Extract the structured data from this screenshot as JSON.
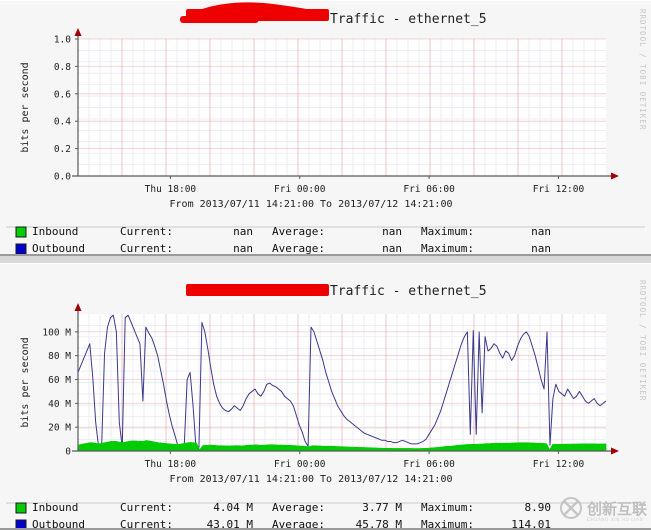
{
  "page": {
    "background_color": "#d8d8d8",
    "panel_background": "#f6f6f6",
    "watermark_vertical": "RRDTOOL / TOBI OETIKER",
    "logo": {
      "name": "chuangxin-hulian-logo",
      "text": "创新互联",
      "subtext": "CHUANG XIN HU LIAN"
    }
  },
  "colors": {
    "inbound": "#00cc00",
    "outbound": "#0000cc",
    "outbound_line": "#3a3a8c",
    "grid_major": "#e8a0a0",
    "grid_minor": "#d8d8e8",
    "axis": "#5a5a5a",
    "arrow": "#a00000",
    "redaction": "#ee0000"
  },
  "graphs": [
    {
      "id": "graph-top",
      "title": "Traffic - ethernet_5",
      "title_redacted": true,
      "ylabel": "bits per second",
      "range_text": "From 2013/07/11 14:21:00 To 2013/07/12 14:21:00",
      "legend": {
        "rows": [
          {
            "name": "Inbound",
            "swatch": "#00cc00",
            "current_label": "Current:",
            "current": "nan",
            "average_label": "Average:",
            "average": "nan",
            "maximum_label": "Maximum:",
            "maximum": "nan"
          },
          {
            "name": "Outbound",
            "swatch": "#0000cc",
            "current_label": "Current:",
            "current": "nan",
            "average_label": "Average:",
            "average": "nan",
            "maximum_label": "Maximum:",
            "maximum": "nan"
          }
        ]
      },
      "chart_data": {
        "type": "area",
        "title": "Traffic - ethernet_5",
        "xlabel": "",
        "ylabel": "bits per second",
        "grid": true,
        "legend_position": "below",
        "ylim": [
          0,
          1.0
        ],
        "yticks": [
          "0.0",
          "0.2",
          "0.4",
          "0.6",
          "0.8",
          "1.0"
        ],
        "ytick_values": [
          0,
          0.2,
          0.4,
          0.6,
          0.8,
          1.0
        ],
        "xticks": [
          "Thu 18:00",
          "Fri 00:00",
          "Fri 06:00",
          "Fri 12:00"
        ],
        "xtick_fractions": [
          0.175,
          0.42,
          0.665,
          0.91
        ],
        "series": [
          {
            "name": "Inbound",
            "values": []
          },
          {
            "name": "Outbound",
            "values": []
          }
        ],
        "note": "no data plotted (all nan)"
      }
    },
    {
      "id": "graph-bottom",
      "title": "Traffic - ethernet_5",
      "title_redacted": true,
      "ylabel": "bits per second",
      "range_text": "From 2013/07/11 14:21:00 To 2013/07/12 14:21:00",
      "legend": {
        "rows": [
          {
            "name": "Inbound",
            "swatch": "#00cc00",
            "current_label": "Current:",
            "current": "4.04 M",
            "average_label": "Average:",
            "average": "3.77 M",
            "maximum_label": "Maximum:",
            "maximum": "8.90"
          },
          {
            "name": "Outbound",
            "swatch": "#0000cc",
            "current_label": "Current:",
            "current": "43.01 M",
            "average_label": "Average:",
            "average": "45.78 M",
            "maximum_label": "Maximum:",
            "maximum": "114.01"
          }
        ]
      },
      "chart_data": {
        "type": "area",
        "title": "Traffic - ethernet_5",
        "xlabel": "",
        "ylabel": "bits per second",
        "grid": true,
        "legend_position": "below",
        "ylim": [
          0,
          115
        ],
        "yticks": [
          "0",
          "20 M",
          "40 M",
          "60 M",
          "80 M",
          "100 M"
        ],
        "ytick_values": [
          0,
          20,
          40,
          60,
          80,
          100
        ],
        "xticks": [
          "Thu 18:00",
          "Fri 00:00",
          "Fri 06:00",
          "Fri 12:00"
        ],
        "xtick_fractions": [
          0.175,
          0.42,
          0.665,
          0.91
        ],
        "units": "bits per second (M = megabits)",
        "series": [
          {
            "name": "Outbound",
            "color": "#0000cc",
            "style": "line",
            "values": [
              66,
              72,
              78,
              84,
              90,
              62,
              24,
              3,
              3,
              82,
              104,
              112,
              114,
              100,
              24,
              3,
              112,
              114,
              108,
              102,
              96,
              90,
              42,
              104,
              99,
              95,
              88,
              80,
              68,
              56,
              42,
              30,
              20,
              12,
              3,
              3,
              3,
              60,
              66,
              38,
              3,
              3,
              108,
              100,
              86,
              70,
              56,
              46,
              40,
              36,
              34,
              33,
              35,
              38,
              36,
              34,
              38,
              44,
              48,
              50,
              52,
              48,
              46,
              50,
              56,
              57,
              55,
              54,
              52,
              50,
              46,
              44,
              42,
              38,
              30,
              22,
              16,
              8,
              4,
              104,
              100,
              92,
              84,
              76,
              66,
              58,
              50,
              44,
              38,
              34,
              30,
              27,
              25,
              23,
              21,
              19,
              17,
              15,
              14,
              13,
              12,
              11,
              10,
              9,
              9,
              8,
              8,
              7,
              7,
              8,
              9,
              8,
              7,
              6,
              6,
              6,
              7,
              8,
              10,
              14,
              18,
              22,
              28,
              34,
              42,
              50,
              58,
              66,
              74,
              82,
              90,
              96,
              100,
              14,
              101,
              14,
              100,
              32,
              96,
              84,
              86,
              90,
              88,
              82,
              78,
              84,
              82,
              76,
              80,
              88,
              94,
              98,
              100,
              96,
              88,
              80,
              70,
              60,
              52,
              100,
              5,
              44,
              56,
              50,
              48,
              46,
              52,
              48,
              44,
              46,
              50,
              46,
              42,
              40,
              42,
              44,
              40,
              38,
              40,
              42
            ]
          },
          {
            "name": "Inbound",
            "color": "#00cc00",
            "style": "area",
            "values": [
              5,
              5.5,
              6,
              6.5,
              7,
              7,
              6.5,
              6,
              6.5,
              7,
              7.5,
              8,
              8.2,
              8,
              7.5,
              7,
              7.5,
              8,
              8.5,
              8.5,
              8.3,
              8.2,
              8,
              8.9,
              8.5,
              8,
              7.5,
              7,
              6.8,
              6.5,
              6.3,
              6,
              5.8,
              5.5,
              5.5,
              6,
              6.5,
              7,
              7.2,
              7,
              6.5,
              1,
              4.5,
              4.8,
              5,
              5,
              4.8,
              4.6,
              4.5,
              4.4,
              4.3,
              4.3,
              4.4,
              4.5,
              4.5,
              4.4,
              4.5,
              4.8,
              5,
              5,
              5.2,
              5,
              4.9,
              5,
              5.2,
              5.3,
              5.2,
              5.1,
              5,
              5,
              4.9,
              4.8,
              4.7,
              4.6,
              4.4,
              4.2,
              4,
              3.8,
              3.6,
              4.5,
              4.4,
              4.3,
              4.2,
              4.1,
              4,
              4,
              3.9,
              3.8,
              3.7,
              3.6,
              3.5,
              3.4,
              3.3,
              3.2,
              3.1,
              3,
              3,
              2.9,
              2.8,
              2.7,
              2.6,
              2.5,
              2.4,
              2.4,
              2.3,
              2.3,
              2.2,
              2.2,
              2.2,
              2.2,
              2.2,
              2.2,
              2.2,
              2.1,
              2.1,
              2.1,
              2.2,
              2.3,
              2.4,
              2.6,
              2.8,
              3,
              3.2,
              3.5,
              3.8,
              4,
              4.2,
              4.5,
              4.8,
              5,
              5.2,
              5.5,
              5.5,
              5.6,
              5.6,
              5.8,
              5.8,
              6,
              6.2,
              6.3,
              6.5,
              6.6,
              6.5,
              6.5,
              6.6,
              6.6,
              6.7,
              6.8,
              6.9,
              7,
              7,
              7,
              6.9,
              6.8,
              6.7,
              6.6,
              6.5,
              6.4,
              6.2,
              1,
              5.5,
              5.6,
              5.6,
              5.7,
              5.7,
              5.8,
              5.8,
              5.8,
              5.9,
              5.9,
              6,
              6,
              6,
              6,
              6,
              5.9,
              5.9,
              5.9,
              6
            ]
          }
        ]
      }
    }
  ]
}
